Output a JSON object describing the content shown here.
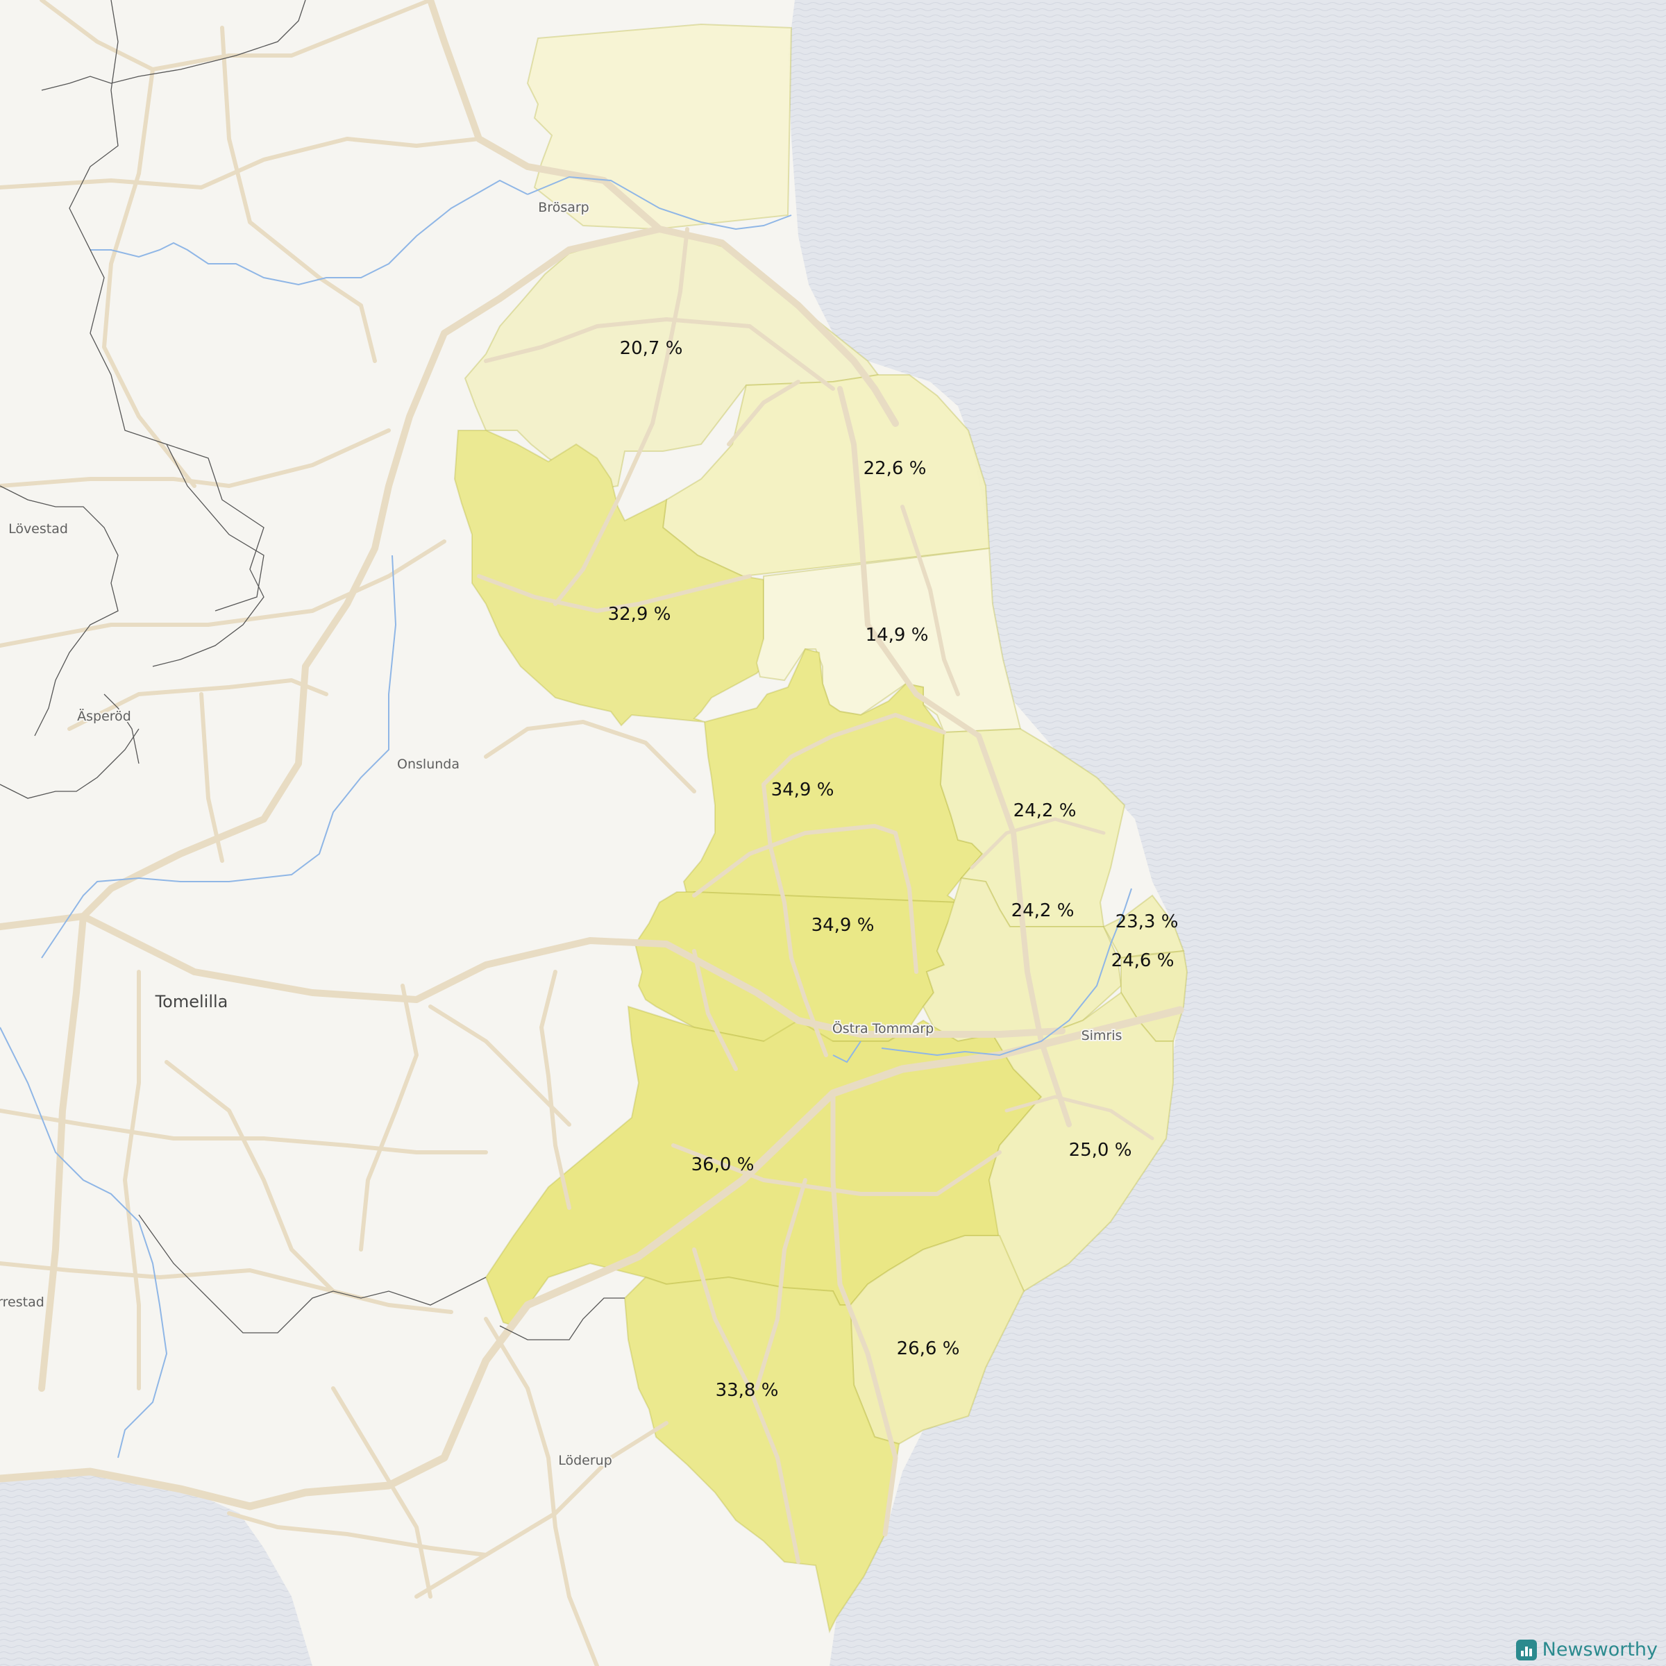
{
  "map": {
    "colors": {
      "land": "#f6f5f1",
      "sea": "#e3e6ec",
      "road": "#e8dcc3",
      "border": "#555555",
      "river": "#8fb6e6",
      "region_low": "#f7f3d2",
      "region_mid": "#f2f1bd",
      "region_high": "#ebe88f"
    },
    "places": [
      {
        "id": "brosarp",
        "name": "Brösarp",
        "kind": "village"
      },
      {
        "id": "lovestad",
        "name": "Lövestad",
        "kind": "village"
      },
      {
        "id": "asperod",
        "name": "Äsperöd",
        "kind": "village"
      },
      {
        "id": "onslunda",
        "name": "Onslunda",
        "kind": "village"
      },
      {
        "id": "tomelilla",
        "name": "Tomelilla",
        "kind": "town"
      },
      {
        "id": "ostra-tommarp",
        "name": "Östra Tommarp",
        "kind": "village"
      },
      {
        "id": "simris",
        "name": "Simris",
        "kind": "village"
      },
      {
        "id": "rrestad",
        "name": "rrestad",
        "kind": "village"
      },
      {
        "id": "loderup",
        "name": "Löderup",
        "kind": "village"
      }
    ],
    "regions": [
      {
        "id": "r1",
        "label": "20,7 %",
        "value": 20.7
      },
      {
        "id": "r2",
        "label": "22,6 %",
        "value": 22.6
      },
      {
        "id": "r3",
        "label": "32,9 %",
        "value": 32.9
      },
      {
        "id": "r4",
        "label": "14,9 %",
        "value": 14.9
      },
      {
        "id": "r5",
        "label": "34,9 %",
        "value": 34.9
      },
      {
        "id": "r6",
        "label": "24,2 %",
        "value": 24.2
      },
      {
        "id": "r7",
        "label": "34,9 %",
        "value": 34.9
      },
      {
        "id": "r8",
        "label": "24,2 %",
        "value": 24.2
      },
      {
        "id": "r9",
        "label": "23,3 %",
        "value": 23.3
      },
      {
        "id": "r10",
        "label": "24,6 %",
        "value": 24.6
      },
      {
        "id": "r11",
        "label": "36,0 %",
        "value": 36.0
      },
      {
        "id": "r12",
        "label": "25,0 %",
        "value": 25.0
      },
      {
        "id": "r13",
        "label": "26,6 %",
        "value": 26.6
      },
      {
        "id": "r14",
        "label": "33,8 %",
        "value": 33.8
      }
    ]
  },
  "brand": {
    "name": "Newsworthy",
    "icon": "bar-chart-icon"
  }
}
